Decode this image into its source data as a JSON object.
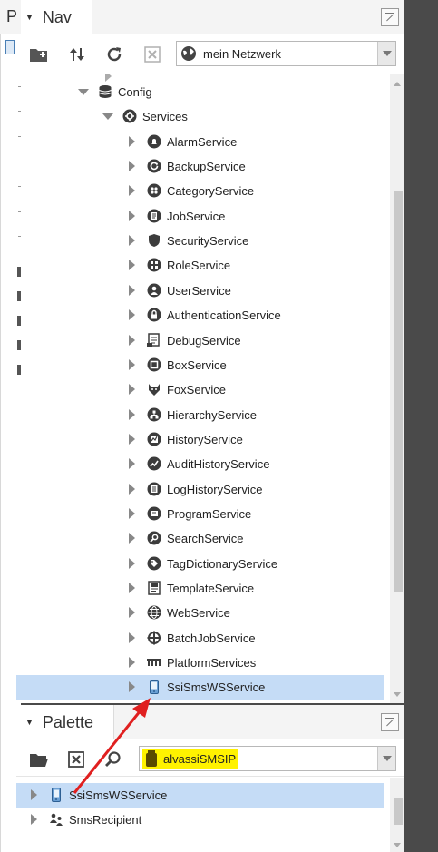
{
  "nav": {
    "title": "Nav",
    "host_select": {
      "value": "mein Netzwerk"
    },
    "tree": [
      {
        "label": "Config",
        "icon": "database-icon",
        "state": "expanded"
      },
      {
        "label": "Services",
        "icon": "services-icon",
        "state": "expanded"
      },
      {
        "label": "AlarmService",
        "icon": "alarm-bell-icon",
        "state": "collapsed"
      },
      {
        "label": "BackupService",
        "icon": "backup-icon",
        "state": "collapsed"
      },
      {
        "label": "CategoryService",
        "icon": "category-icon",
        "state": "collapsed"
      },
      {
        "label": "JobService",
        "icon": "job-icon",
        "state": "collapsed"
      },
      {
        "label": "SecurityService",
        "icon": "shield-icon",
        "state": "collapsed"
      },
      {
        "label": "RoleService",
        "icon": "role-icon",
        "state": "collapsed"
      },
      {
        "label": "UserService",
        "icon": "user-icon",
        "state": "collapsed"
      },
      {
        "label": "AuthenticationService",
        "icon": "lock-icon",
        "state": "collapsed"
      },
      {
        "label": "DebugService",
        "icon": "debug-icon",
        "state": "collapsed"
      },
      {
        "label": "BoxService",
        "icon": "box-icon",
        "state": "collapsed"
      },
      {
        "label": "FoxService",
        "icon": "fox-icon",
        "state": "collapsed"
      },
      {
        "label": "HierarchyService",
        "icon": "hierarchy-icon",
        "state": "collapsed"
      },
      {
        "label": "HistoryService",
        "icon": "history-icon",
        "state": "collapsed"
      },
      {
        "label": "AuditHistoryService",
        "icon": "audit-history-icon",
        "state": "collapsed"
      },
      {
        "label": "LogHistoryService",
        "icon": "log-history-icon",
        "state": "collapsed"
      },
      {
        "label": "ProgramService",
        "icon": "program-icon",
        "state": "collapsed"
      },
      {
        "label": "SearchService",
        "icon": "search-icon",
        "state": "collapsed"
      },
      {
        "label": "TagDictionaryService",
        "icon": "tag-icon",
        "state": "collapsed"
      },
      {
        "label": "TemplateService",
        "icon": "template-icon",
        "state": "collapsed"
      },
      {
        "label": "WebService",
        "icon": "globe-icon",
        "state": "collapsed"
      },
      {
        "label": "BatchJobService",
        "icon": "batch-job-icon",
        "state": "collapsed"
      },
      {
        "label": "PlatformServices",
        "icon": "platform-icon",
        "state": "collapsed"
      },
      {
        "label": "SsiSmsWSService",
        "icon": "phone-icon",
        "state": "collapsed",
        "selected": true
      }
    ]
  },
  "palette": {
    "title": "Palette",
    "module_select": {
      "value": "alvassiSMSIP"
    },
    "items": [
      {
        "label": "SsiSmsWSService",
        "icon": "phone-icon",
        "selected": true
      },
      {
        "label": "SmsRecipient",
        "icon": "recipient-group-icon",
        "selected": false
      }
    ]
  },
  "right_panel": {
    "title": "P"
  },
  "colors": {
    "selection": "#c5dcf6",
    "highlight": "#fff200",
    "annotation_arrow": "#e02020"
  }
}
